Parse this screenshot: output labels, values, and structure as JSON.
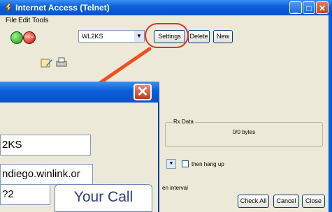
{
  "background_window": {
    "title": "Internet Access (Telnet)",
    "menu": [
      "File",
      "Edit",
      "Tools"
    ],
    "callsign_combo": "WL2KS",
    "settings_label": "Settings",
    "delete_label": "Delete",
    "new_label": "New",
    "rx_data_label": "Rx Data",
    "rx_bytes": "0/0 bytes",
    "hang_up_label": "then hang up",
    "interval_label": "en interval",
    "check_all_label": "Check All",
    "cancel_label": "Cancel",
    "close_label": "Close"
  },
  "settings_dialog": {
    "field1_value": "2KS",
    "field2_value": "ndiego.winlink.or",
    "field3_value": "?2",
    "callout_text": "Your Call"
  },
  "colors": {
    "highlight_circle": "#d9342a",
    "arrow": "#f0501e",
    "titlebar": "#0a5fd8"
  }
}
